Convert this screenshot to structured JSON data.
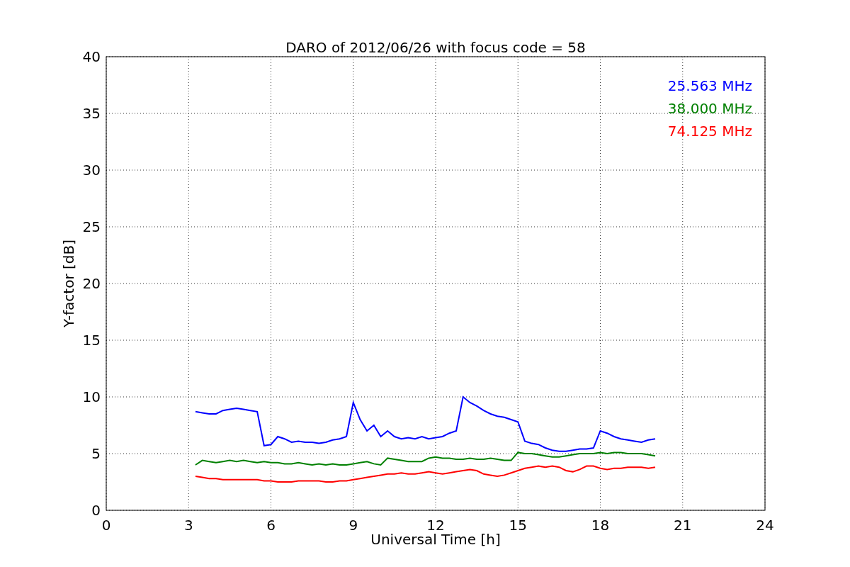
{
  "figure": {
    "chart_data": {
      "type": "line",
      "title": "DARO of 2012/06/26 with focus code = 58",
      "xlabel": "Universal Time [h]",
      "ylabel": "Y-factor [dB]",
      "x": [
        3.25,
        3.5,
        3.75,
        4.0,
        4.25,
        4.5,
        4.75,
        5.0,
        5.25,
        5.5,
        5.75,
        6.0,
        6.25,
        6.5,
        6.75,
        7.0,
        7.25,
        7.5,
        7.75,
        8.0,
        8.25,
        8.5,
        8.75,
        9.0,
        9.25,
        9.5,
        9.75,
        10.0,
        10.25,
        10.5,
        10.75,
        11.0,
        11.25,
        11.5,
        11.75,
        12.0,
        12.25,
        12.5,
        12.75,
        13.0,
        13.25,
        13.5,
        13.75,
        14.0,
        14.25,
        14.5,
        14.75,
        15.0,
        15.25,
        15.5,
        15.75,
        16.0,
        16.25,
        16.5,
        16.75,
        17.0,
        17.25,
        17.5,
        17.75,
        18.0,
        18.25,
        18.5,
        18.75,
        19.0,
        19.25,
        19.5,
        19.75,
        20.0
      ],
      "series": [
        {
          "name": "25.563 MHz",
          "color": "#0000ff",
          "values": [
            8.7,
            8.6,
            8.5,
            8.5,
            8.8,
            8.9,
            9.0,
            8.9,
            8.8,
            8.7,
            5.7,
            5.8,
            6.5,
            6.3,
            6.0,
            6.1,
            6.0,
            6.0,
            5.9,
            6.0,
            6.2,
            6.3,
            6.5,
            9.5,
            8.0,
            7.0,
            7.5,
            6.5,
            7.0,
            6.5,
            6.3,
            6.4,
            6.3,
            6.5,
            6.3,
            6.4,
            6.5,
            6.8,
            7.0,
            10.0,
            9.5,
            9.2,
            8.8,
            8.5,
            8.3,
            8.2,
            8.0,
            7.8,
            6.1,
            5.9,
            5.8,
            5.5,
            5.3,
            5.2,
            5.2,
            5.3,
            5.4,
            5.4,
            5.5,
            7.0,
            6.8,
            6.5,
            6.3,
            6.2,
            6.1,
            6.0,
            6.2,
            6.3
          ]
        },
        {
          "name": "38.000 MHz",
          "color": "#008000",
          "values": [
            4.0,
            4.4,
            4.3,
            4.2,
            4.3,
            4.4,
            4.3,
            4.4,
            4.3,
            4.2,
            4.3,
            4.2,
            4.2,
            4.1,
            4.1,
            4.2,
            4.1,
            4.0,
            4.1,
            4.0,
            4.1,
            4.0,
            4.0,
            4.1,
            4.2,
            4.3,
            4.1,
            4.0,
            4.6,
            4.5,
            4.4,
            4.3,
            4.3,
            4.3,
            4.6,
            4.7,
            4.6,
            4.6,
            4.5,
            4.5,
            4.6,
            4.5,
            4.5,
            4.6,
            4.5,
            4.4,
            4.4,
            5.1,
            5.0,
            5.0,
            4.9,
            4.8,
            4.7,
            4.7,
            4.8,
            4.9,
            5.0,
            5.0,
            5.0,
            5.1,
            5.0,
            5.1,
            5.1,
            5.0,
            5.0,
            5.0,
            4.9,
            4.8
          ]
        },
        {
          "name": "74.125 MHz",
          "color": "#ff0000",
          "values": [
            3.0,
            2.9,
            2.8,
            2.8,
            2.7,
            2.7,
            2.7,
            2.7,
            2.7,
            2.7,
            2.6,
            2.6,
            2.5,
            2.5,
            2.5,
            2.6,
            2.6,
            2.6,
            2.6,
            2.5,
            2.5,
            2.6,
            2.6,
            2.7,
            2.8,
            2.9,
            3.0,
            3.1,
            3.2,
            3.2,
            3.3,
            3.2,
            3.2,
            3.3,
            3.4,
            3.3,
            3.2,
            3.3,
            3.4,
            3.5,
            3.6,
            3.5,
            3.2,
            3.1,
            3.0,
            3.1,
            3.3,
            3.5,
            3.7,
            3.8,
            3.9,
            3.8,
            3.9,
            3.8,
            3.5,
            3.4,
            3.6,
            3.9,
            3.9,
            3.7,
            3.6,
            3.7,
            3.7,
            3.8,
            3.8,
            3.8,
            3.7,
            3.8
          ]
        }
      ],
      "grid": true,
      "xlim": [
        0,
        24
      ],
      "ylim": [
        0,
        40
      ],
      "xticks": [
        0,
        3,
        6,
        9,
        12,
        15,
        18,
        21,
        24
      ],
      "yticks": [
        0,
        5,
        10,
        15,
        20,
        25,
        30,
        35,
        40
      ]
    }
  }
}
